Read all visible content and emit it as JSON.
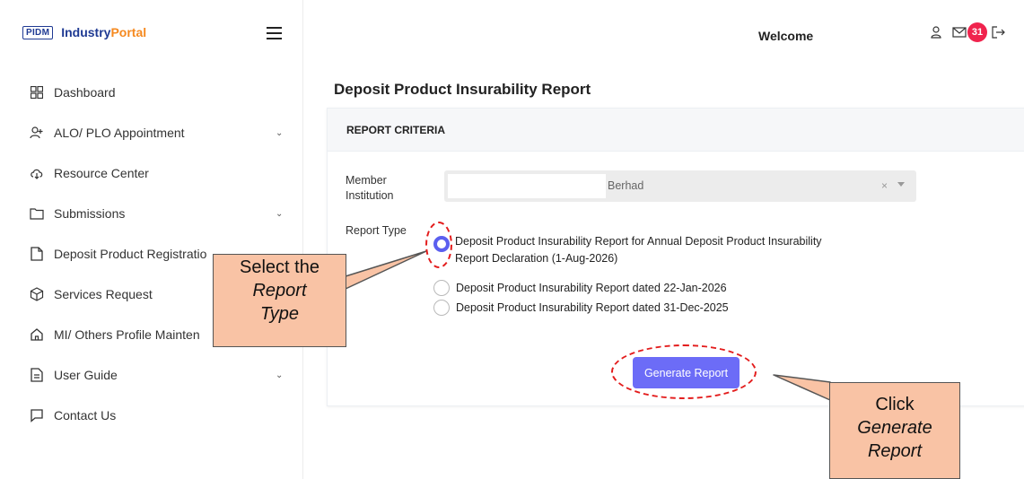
{
  "brand": {
    "badge": "PIDM",
    "name_part1": "Industry",
    "name_part2": "Portal"
  },
  "header": {
    "welcome": "Welcome",
    "notification_count": "31",
    "icons": [
      "user-icon",
      "mail-icon",
      "logout-icon"
    ]
  },
  "sidebar": {
    "items": [
      {
        "label": "Dashboard",
        "icon": "dashboard-grid-icon",
        "has_chevron": false
      },
      {
        "label": "ALO/ PLO Appointment",
        "icon": "user-add-icon",
        "has_chevron": true
      },
      {
        "label": "Resource Center",
        "icon": "cloud-icon",
        "has_chevron": false
      },
      {
        "label": "Submissions",
        "icon": "folder-icon",
        "has_chevron": true
      },
      {
        "label": "Deposit Product Registratio",
        "icon": "file-icon",
        "has_chevron": false
      },
      {
        "label": "Services Request",
        "icon": "box-icon",
        "has_chevron": false
      },
      {
        "label": "MI/ Others Profile Mainten",
        "icon": "home-icon",
        "has_chevron": false
      },
      {
        "label": "User Guide",
        "icon": "document-icon",
        "has_chevron": true
      },
      {
        "label": "Contact Us",
        "icon": "chat-icon",
        "has_chevron": false
      }
    ]
  },
  "main": {
    "page_title": "Deposit Product Insurability Report",
    "card_header": "REPORT CRITERIA",
    "member_label_line1": "Member",
    "member_label_line2": "Institution",
    "member_value": "Berhad",
    "member_clear": "×",
    "report_type_label": "Report Type",
    "report_options": [
      {
        "line1": "Deposit Product Insurability Report for Annual Deposit Product Insurability",
        "line2": "Report Declaration (1-Aug-2026)",
        "checked": true
      },
      {
        "line1": "Deposit Product Insurability Report dated 22-Jan-2026",
        "line2": "",
        "checked": false
      },
      {
        "line1": "Deposit Product Insurability Report dated 31-Dec-2025",
        "line2": "",
        "checked": false
      }
    ],
    "generate_button": "Generate Report"
  },
  "annotations": {
    "callout1_line1": "Select the",
    "callout1_line2": "Report",
    "callout1_line3": "Type",
    "callout2_line1": "Click",
    "callout2_line2": "Generate",
    "callout2_line3": "Report",
    "highlight_color": "#e31c1c",
    "callout_fill": "#f9c3a5"
  },
  "colors": {
    "accent": "#6c6cf7",
    "brand_blue": "#1f3a93",
    "brand_orange": "#f5891f",
    "badge_red": "#f0234d"
  }
}
